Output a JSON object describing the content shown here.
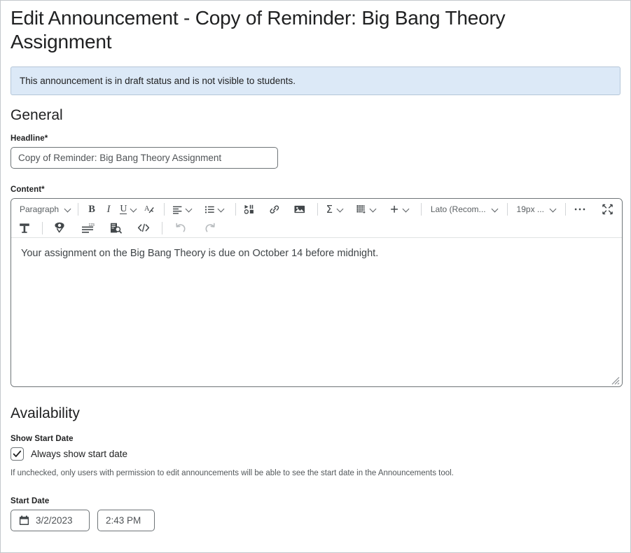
{
  "page": {
    "title": "Edit Announcement - Copy of Reminder: Big Bang Theory Assignment",
    "notice": "This announcement is in draft status and is not visible to students."
  },
  "general": {
    "heading": "General",
    "headline": {
      "label": "Headline",
      "required_marker": "*",
      "value": "Copy of Reminder: Big Bang Theory Assignment",
      "placeholder": "Headline"
    },
    "content": {
      "label": "Content",
      "required_marker": "*",
      "body_text": "Your assignment on the Big Bang Theory is due on October 14 before midnight."
    }
  },
  "editor_toolbar": {
    "paragraph_style": "Paragraph",
    "font_name": "Lato (Recom...",
    "font_size": "19px ...",
    "row1": [
      {
        "name": "paragraph-style-dropdown",
        "label": "Paragraph",
        "type": "dropdown"
      },
      {
        "name": "bold-button",
        "label": "B",
        "type": "glyph"
      },
      {
        "name": "italic-button",
        "label": "I",
        "type": "glyph"
      },
      {
        "name": "underline-button",
        "label": "U",
        "type": "glyph-dropdown"
      },
      {
        "name": "clear-formatting-button",
        "label": "A",
        "type": "icon"
      },
      {
        "name": "align-left-button",
        "label": "Align",
        "type": "icon-dropdown"
      },
      {
        "name": "bulleted-list-button",
        "label": "List",
        "type": "icon-dropdown"
      },
      {
        "name": "insert-stuff-button",
        "label": "Insert Stuff",
        "type": "icon"
      },
      {
        "name": "insert-link-button",
        "label": "Insert Link",
        "type": "icon"
      },
      {
        "name": "insert-image-button",
        "label": "Insert Image",
        "type": "icon"
      },
      {
        "name": "equation-button",
        "label": "Equation",
        "type": "icon-dropdown"
      },
      {
        "name": "insert-table-button",
        "label": "Table",
        "type": "icon-dropdown"
      },
      {
        "name": "add-more-button",
        "label": "Add",
        "type": "icon-dropdown"
      },
      {
        "name": "font-name-dropdown",
        "label": "Lato (Recom...",
        "type": "dropdown"
      },
      {
        "name": "font-size-dropdown",
        "label": "19px ...",
        "type": "dropdown"
      },
      {
        "name": "more-options-button",
        "label": "More",
        "type": "icon"
      },
      {
        "name": "fullscreen-button",
        "label": "Fullscreen",
        "type": "icon"
      }
    ],
    "row2": [
      {
        "name": "format-painter-button",
        "label": "Format Painter"
      },
      {
        "name": "accessibility-check-button",
        "label": "Accessibility Check"
      },
      {
        "name": "word-count-button",
        "label": "Word Count"
      },
      {
        "name": "preview-button",
        "label": "Preview"
      },
      {
        "name": "html-source-button",
        "label": "HTML Source"
      },
      {
        "name": "undo-button",
        "label": "Undo"
      },
      {
        "name": "redo-button",
        "label": "Redo"
      }
    ]
  },
  "availability": {
    "heading": "Availability",
    "show_start_date": {
      "label": "Show Start Date",
      "checkbox_label": "Always show start date",
      "checked": true,
      "help_text": "If unchecked, only users with permission to edit announcements will be able to see the start date in the Announcements tool."
    },
    "start_date": {
      "label": "Start Date",
      "date_value": "3/2/2023",
      "time_value": "2:43 PM"
    }
  },
  "colors": {
    "notice_background": "#dce9f7",
    "notice_border": "#b5c6d8",
    "field_border": "#6e7477",
    "text": "#202122",
    "muted_text": "#53585b",
    "toolbar_icon": "#4a4f52"
  }
}
